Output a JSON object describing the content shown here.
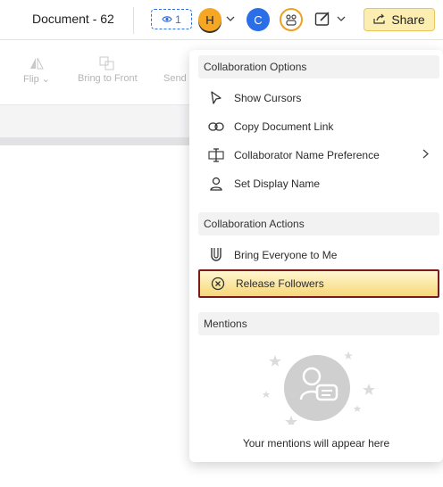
{
  "header": {
    "doc_title": "Document - 62",
    "viewer_count": "1",
    "avatars": [
      {
        "initial": "H",
        "color": "#f5a623"
      },
      {
        "initial": "C",
        "color": "#2b6fe8"
      }
    ],
    "share_label": "Share"
  },
  "toolbar": {
    "flip_label": "Flip",
    "bring_front_label": "Bring to Front",
    "send_label": "Send"
  },
  "menu": {
    "sections": [
      {
        "title": "Collaboration Options",
        "items": [
          {
            "label": "Show Cursors",
            "icon": "cursor-icon"
          },
          {
            "label": "Copy Document Link",
            "icon": "link-icon"
          },
          {
            "label": "Collaborator Name Preference",
            "icon": "text-cursor-icon",
            "has_submenu": true
          },
          {
            "label": "Set Display Name",
            "icon": "person-icon"
          }
        ]
      },
      {
        "title": "Collaboration Actions",
        "items": [
          {
            "label": "Bring Everyone to Me",
            "icon": "magnet-icon"
          },
          {
            "label": "Release Followers",
            "icon": "close-circle-icon",
            "selected": true
          }
        ]
      },
      {
        "title": "Mentions",
        "items": []
      }
    ],
    "mentions_empty_message": "Your mentions will appear here"
  },
  "colors": {
    "accent_blue": "#2f6fe0",
    "share_bg": "#fbeeb0",
    "selected_border": "#7b1a1a"
  }
}
